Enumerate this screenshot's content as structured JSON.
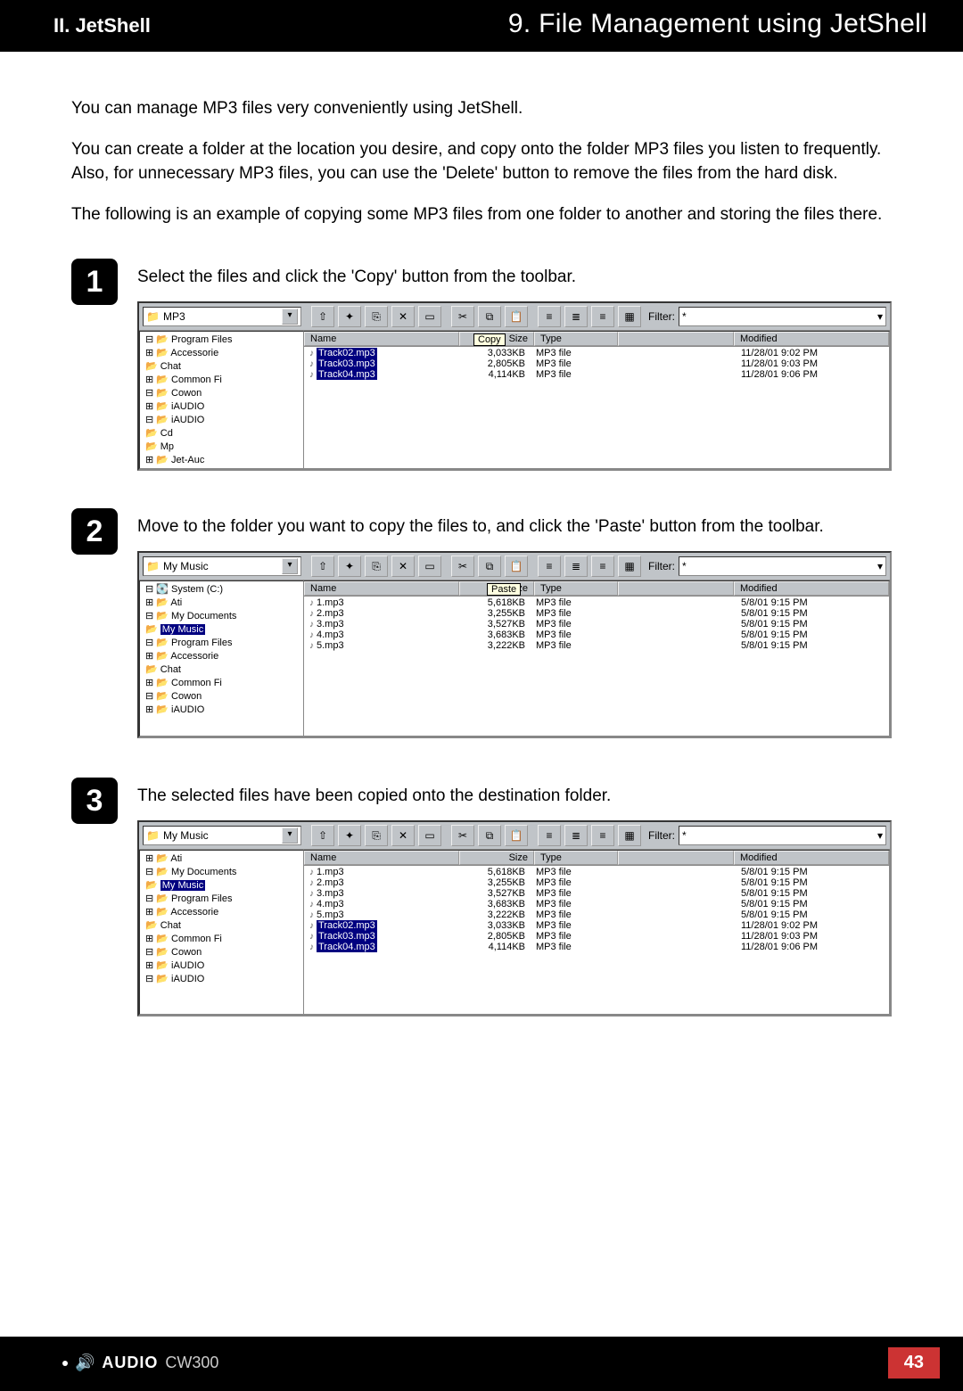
{
  "header": {
    "section": "II. JetShell",
    "title": "9. File Management using JetShell"
  },
  "intro": {
    "p1": "You can manage MP3 files very conveniently using JetShell.",
    "p2": "You can create a folder at the location you desire, and copy onto the folder MP3 files you listen to frequently. Also, for unnecessary MP3 files, you can use the 'Delete' button to remove the files from the hard disk.",
    "p3": "The following is an example of copying some MP3 files from one folder to another and storing the files there."
  },
  "steps": {
    "s1": {
      "num": "1",
      "text": "Select the files and click the 'Copy' button from the toolbar."
    },
    "s2": {
      "num": "2",
      "text": "Move to the folder you want to copy the files to, and click the 'Paste' button from the toolbar."
    },
    "s3": {
      "num": "3",
      "text": "The selected files have been copied onto the destination folder."
    }
  },
  "common": {
    "filter_label": "Filter:",
    "filter_value": "*",
    "cols": {
      "name": "Name",
      "size": "Size",
      "type": "Type",
      "modified": "Modified"
    }
  },
  "shot1": {
    "combo": "MP3",
    "tooltip": "Copy",
    "tree": [
      "⊟ 📂 Program Files",
      "  ⊞ 📂 Accessorie",
      "    📂 Chat",
      "  ⊞ 📂 Common Fi",
      "  ⊟ 📂 Cowon",
      "    ⊞ 📂 iAUDIO",
      "    ⊟ 📂 iAUDIO",
      "        📂 Cd",
      "        📂 Mp",
      "  ⊞ 📂 Jet-Auc"
    ],
    "rows": [
      {
        "name": "Track02.mp3",
        "size": "3,033KB",
        "type": "MP3 file",
        "mod": "11/28/01 9:02 PM",
        "sel": true
      },
      {
        "name": "Track03.mp3",
        "size": "2,805KB",
        "type": "MP3 file",
        "mod": "11/28/01 9:03 PM",
        "sel": true
      },
      {
        "name": "Track04.mp3",
        "size": "4,114KB",
        "type": "MP3 file",
        "mod": "11/28/01 9:06 PM",
        "sel": true
      }
    ]
  },
  "shot2": {
    "combo": "My Music",
    "tooltip": "Paste",
    "tree": [
      "⊟ 💽 System (C:)",
      "  ⊞ 📂 Ati",
      "  ⊟ 📂 My Documents",
      "      📂 My Music",
      "  ⊟ 📂 Program Files",
      "    ⊞ 📂 Accessorie",
      "      📂 Chat",
      "    ⊞ 📂 Common Fi",
      "    ⊟ 📂 Cowon",
      "      ⊞ 📂 iAUDIO"
    ],
    "tree_sel": "My Music",
    "rows": [
      {
        "name": "1.mp3",
        "size": "5,618KB",
        "type": "MP3 file",
        "mod": "5/8/01 9:15 PM"
      },
      {
        "name": "2.mp3",
        "size": "3,255KB",
        "type": "MP3 file",
        "mod": "5/8/01 9:15 PM"
      },
      {
        "name": "3.mp3",
        "size": "3,527KB",
        "type": "MP3 file",
        "mod": "5/8/01 9:15 PM"
      },
      {
        "name": "4.mp3",
        "size": "3,683KB",
        "type": "MP3 file",
        "mod": "5/8/01 9:15 PM"
      },
      {
        "name": "5.mp3",
        "size": "3,222KB",
        "type": "MP3 file",
        "mod": "5/8/01 9:15 PM"
      }
    ]
  },
  "shot3": {
    "combo": "My Music",
    "tree": [
      "⊞ 📂 Ati",
      "⊟ 📂 My Documents",
      "    📂 My Music",
      "⊟ 📂 Program Files",
      "  ⊞ 📂 Accessorie",
      "    📂 Chat",
      "  ⊞ 📂 Common Fi",
      "  ⊟ 📂 Cowon",
      "    ⊞ 📂 iAUDIO",
      "    ⊟ 📂 iAUDIO"
    ],
    "tree_sel": "My Music",
    "rows": [
      {
        "name": "1.mp3",
        "size": "5,618KB",
        "type": "MP3 file",
        "mod": "5/8/01 9:15 PM"
      },
      {
        "name": "2.mp3",
        "size": "3,255KB",
        "type": "MP3 file",
        "mod": "5/8/01 9:15 PM"
      },
      {
        "name": "3.mp3",
        "size": "3,527KB",
        "type": "MP3 file",
        "mod": "5/8/01 9:15 PM"
      },
      {
        "name": "4.mp3",
        "size": "3,683KB",
        "type": "MP3 file",
        "mod": "5/8/01 9:15 PM"
      },
      {
        "name": "5.mp3",
        "size": "3,222KB",
        "type": "MP3 file",
        "mod": "5/8/01 9:15 PM"
      },
      {
        "name": "Track02.mp3",
        "size": "3,033KB",
        "type": "MP3 file",
        "mod": "11/28/01 9:02 PM",
        "sel": true
      },
      {
        "name": "Track03.mp3",
        "size": "2,805KB",
        "type": "MP3 file",
        "mod": "11/28/01 9:03 PM",
        "sel": true
      },
      {
        "name": "Track04.mp3",
        "size": "4,114KB",
        "type": "MP3 file",
        "mod": "11/28/01 9:06 PM",
        "sel": true
      }
    ]
  },
  "footer": {
    "brand": "AUDIO",
    "model": "CW300",
    "page": "43"
  }
}
